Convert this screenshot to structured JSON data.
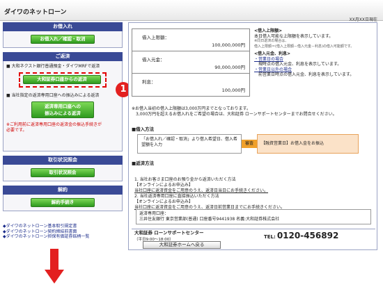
{
  "header": {
    "title": "ダイワのネットローン",
    "date": "XX月XX日現在"
  },
  "left": {
    "borrow": {
      "heading": "お借入れ",
      "button": "お借入れ／確認・取消"
    },
    "repay": {
      "heading": "ご返済",
      "line1": "大和ネクスト銀行普通預金・ダイワMRFで返済",
      "button": "大和証券口座からの返済",
      "line2": "当社指定の返済専用口座への振込みによる返済",
      "button2a": "返済専用口座への",
      "button2b": "振込みによる返済",
      "note1": "※ご利用前に返済専用口座の返済金の振込手続きが",
      "note2": "必要です。"
    },
    "history": {
      "heading": "取引状況照会",
      "button": "取引状況照会"
    },
    "cancel": {
      "heading": "解約",
      "button": "解約手続き"
    },
    "links": [
      "◆ダイワのネットローン基本取引規定書",
      "◆ダイワのネットローン契約締結前書面",
      "◆ダイワのネットローン担保有価証券銘柄一覧"
    ],
    "marker": "1"
  },
  "right": {
    "limit_label": "借入上限額：",
    "limit_value": "100,000,000円",
    "principal_label": "借入元金：",
    "principal_value": "90,000,000円",
    "interest_label": "利息：",
    "interest_value": "100,000円",
    "notes": {
      "t1": "<借入上限額>",
      "l1": "本日借入可能な上限額を表示しています。",
      "s1": "※同日返済の場合は、",
      "s2": "借入上限額＝(借入上限額－借入元金－利息)の借入可能額です。",
      "t2": "<借入元金、利息>",
      "l2": "・営業日の場合",
      "l3": "　現時点の借入元金、利息を表示しています。",
      "l4": "・営業日以外の場合",
      "l5": "　前営業日時点の借入元金、利息を表示しています。"
    },
    "warn1": "※お借入当初の借入上限額は3,000万円までとなっております。",
    "warn2": "　3,000万円を超えるお借入れをご希望の場合は、大和証券 ローンサポートセンターまでお問合せください。",
    "borrow_title": "■借入方法",
    "flow_left1": "「お借入れ／確認・取消」より借入希望日、借入希",
    "flow_left2": "望額を入力",
    "flow_arrow": "審査",
    "flow_right": "【融資営業日】お借入金をお振込",
    "repay_title": "■返済方法",
    "rem1": "1. 当社お客さま口座のお預り金から返済いただく方法",
    "rem2": "【オンラインによるお申込み】",
    "rem3": "当社口座に返済資金をご用意のうえ、返済日当日にお手続きください。",
    "rem4": "2. 当社返済専用口座に直接振込いただく方法",
    "rem5": "【オンラインによるお申込み】",
    "rem6": "当社口座に返済資金をご用意のうえ、返済日前営業日までにお手続きください。",
    "acct1": "返済専用口座：",
    "acct2": "三井住友銀行 東京営業部(普通) 口座番号9441938 名義:大和証券株式会社",
    "support_name": "大和証券 ローンサポートセンター",
    "support_hours": "（平日9:00〜18:00）",
    "tel_label": "TEL:",
    "tel": "0120-456892",
    "home_button": "大和証券ホームへ戻る"
  }
}
